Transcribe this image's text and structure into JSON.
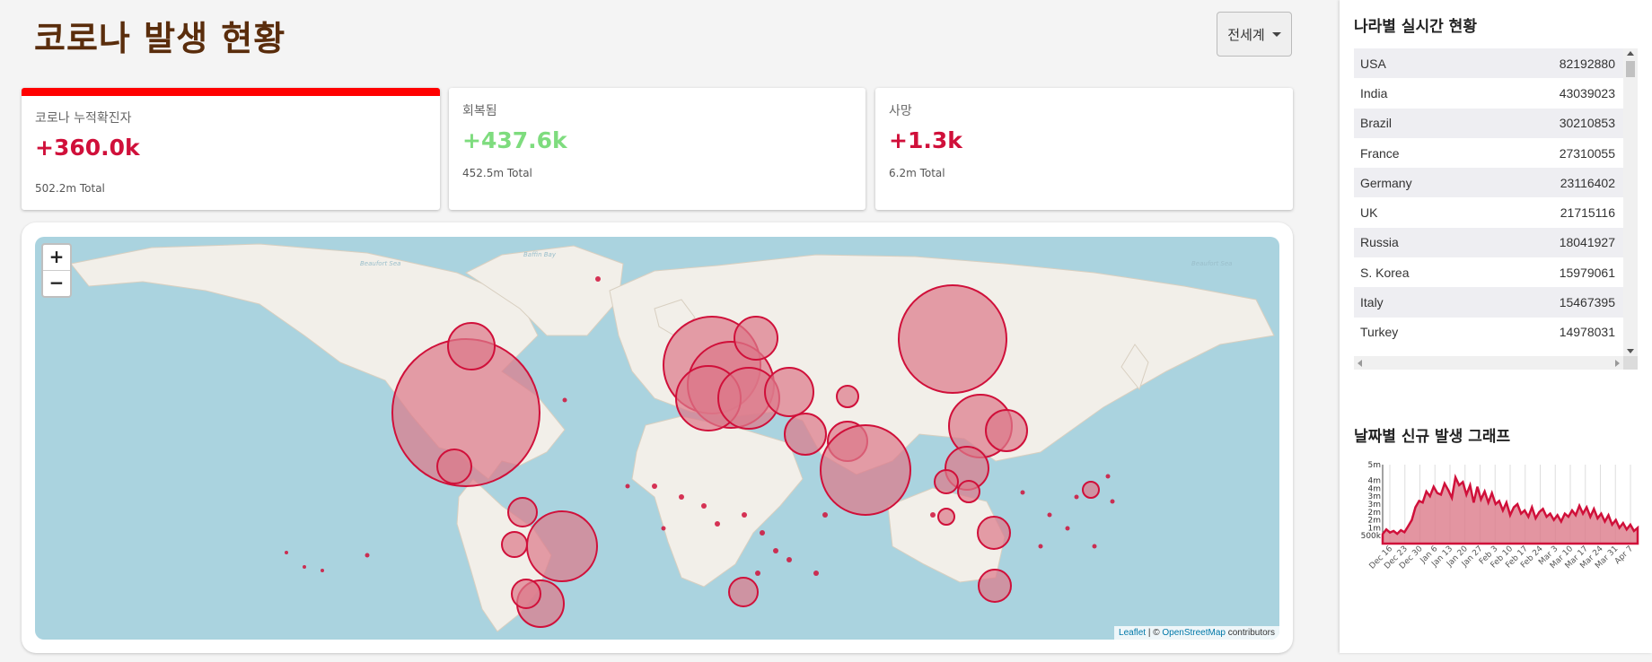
{
  "header": {
    "title": "코로나 발생 현황",
    "region_selector": "전세계"
  },
  "stats": {
    "confirmed": {
      "label": "코로나 누적확진자",
      "value": "+360.0k",
      "total": "502.2m Total"
    },
    "recovered": {
      "label": "회복됨",
      "value": "+437.6k",
      "total": "452.5m Total"
    },
    "deaths": {
      "label": "사망",
      "value": "+1.3k",
      "total": "6.2m Total"
    }
  },
  "colors": {
    "accent_red": "#d0103a",
    "top_bar": "#ff0000",
    "recovered_green": "#7edc7e",
    "title_brown": "#5a2d0c",
    "bubble_fill": "#dc7a8a",
    "bubble_stroke": "#d0103a",
    "ocean": "#aad3df",
    "land": "#f2efe9"
  },
  "map": {
    "zoom_in": "+",
    "zoom_out": "−",
    "attribution": {
      "leaflet": "Leaflet",
      "separator": " | © ",
      "osm": "OpenStreetMap",
      "suffix": " contributors"
    },
    "sea_labels": [
      "Beaufort Sea",
      "Baffin Bay",
      "Beaufort Sea"
    ]
  },
  "sidebar": {
    "countries_title": "나라별 실시간 현황",
    "countries": [
      {
        "name": "USA",
        "value": "82192880"
      },
      {
        "name": "India",
        "value": "43039023"
      },
      {
        "name": "Brazil",
        "value": "30210853"
      },
      {
        "name": "France",
        "value": "27310055"
      },
      {
        "name": "Germany",
        "value": "23116402"
      },
      {
        "name": "UK",
        "value": "21715116"
      },
      {
        "name": "Russia",
        "value": "18041927"
      },
      {
        "name": "S. Korea",
        "value": "15979061"
      },
      {
        "name": "Italy",
        "value": "15467395"
      },
      {
        "name": "Turkey",
        "value": "14978031"
      }
    ],
    "chart_title": "날짜별 신규 발생 그래프"
  },
  "chart_data": {
    "type": "area",
    "title": "",
    "y_ticks": [
      "500k",
      "1m",
      "2m",
      "2m",
      "3m",
      "3m",
      "4m",
      "4m",
      "5m"
    ],
    "x_ticks": [
      "Dec 16",
      "Dec 23",
      "Dec 30",
      "Jan 6",
      "Jan 13",
      "Jan 20",
      "Jan 27",
      "Feb 3",
      "Feb 10",
      "Feb 17",
      "Feb 24",
      "Mar 3",
      "Mar 10",
      "Mar 17",
      "Mar 24",
      "Mar 31",
      "Apr 7"
    ],
    "ylim": [
      0,
      5000000
    ],
    "grid": "vertical",
    "values": [
      600000,
      900000,
      700000,
      800000,
      620000,
      850000,
      720000,
      1100000,
      1500000,
      2300000,
      2700000,
      2600000,
      3300000,
      3000000,
      3600000,
      3200000,
      3100000,
      3800000,
      3400000,
      2900000,
      4200000,
      3700000,
      3900000,
      3100000,
      3700000,
      2600000,
      3600000,
      2800000,
      3300000,
      2600000,
      3200000,
      2500000,
      2700000,
      2100000,
      2600000,
      1800000,
      2300000,
      2500000,
      1900000,
      2100000,
      1700000,
      2300000,
      1600000,
      2000000,
      2200000,
      1700000,
      1900000,
      1500000,
      1800000,
      1400000,
      1900000,
      1700000,
      2100000,
      1800000,
      2400000,
      1900000,
      2300000,
      1700000,
      2200000,
      1600000,
      1900000,
      1400000,
      1800000,
      1200000,
      1500000,
      1000000,
      1300000,
      900000,
      1200000,
      800000,
      1000000
    ]
  }
}
